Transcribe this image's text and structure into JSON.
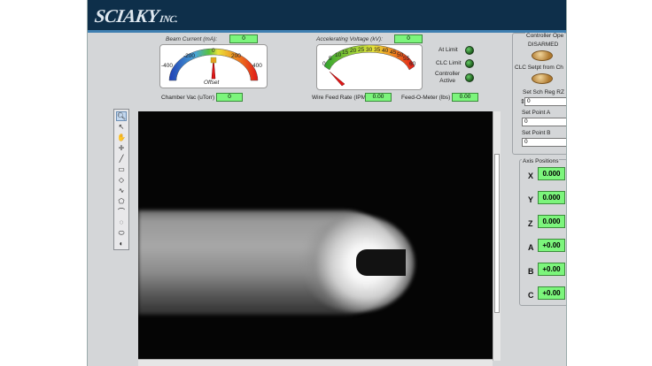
{
  "app": {
    "logo_text": "SCIAKY",
    "logo_suffix": "INC."
  },
  "beam_current": {
    "title": "Beam Current (mA):",
    "value": "0",
    "ticks": [
      "-400",
      "-200",
      "0",
      "200",
      "400"
    ],
    "center_label": "Offset",
    "offset_value": "0"
  },
  "accel_voltage": {
    "title": "Accelerating Voltage (kV):",
    "value": "0",
    "ticks": [
      "0",
      "5",
      "10",
      "15",
      "20",
      "25",
      "30",
      "35",
      "40",
      "45",
      "50",
      "55",
      "60"
    ]
  },
  "status": {
    "at_limit": "At Limit",
    "clc_limit": "CLC Limit",
    "controller_active_line1": "Controller",
    "controller_active_line2": "Active"
  },
  "readouts": {
    "chamber_vac_label": "Chamber Vac (uTorr)",
    "chamber_vac_value": "0",
    "wire_feed_label": "Wire Feed Rate (IPM)",
    "wire_feed_value": "0.00",
    "feed_o_meter_label": "Feed-O-Meter (lbs)",
    "feed_o_meter_value": "0.00"
  },
  "controller": {
    "title": "Controller Ope",
    "disarmed_label": "DISARMED",
    "clc_setpt_label": "CLC Setpt from Ch",
    "sch_reg_label": "Set Sch Reg RZ",
    "sch_reg_value": "0",
    "setpoint_a_label": "Set Point A",
    "setpoint_a_value": "0",
    "setpoint_b_label": "Set Point B",
    "setpoint_b_value": "0"
  },
  "axis_positions": {
    "title": "Axis Positions",
    "axes": [
      {
        "name": "X",
        "value": "0.000"
      },
      {
        "name": "Y",
        "value": "0.000"
      },
      {
        "name": "Z",
        "value": "0.000"
      },
      {
        "name": "A",
        "value": "+0.00"
      },
      {
        "name": "B",
        "value": "+0.00"
      },
      {
        "name": "C",
        "value": "+0.00"
      }
    ]
  },
  "tools": [
    "zoom-icon",
    "pointer-icon",
    "pan-icon",
    "crosshair-icon",
    "line-icon",
    "rectangle-icon",
    "rotated-rect-icon",
    "freehand-icon",
    "polygon-icon",
    "curve-icon",
    "annulus-icon",
    "ellipse-icon",
    "circle-icon"
  ],
  "colors": {
    "indicator_green": "#7cf57c",
    "header": "#0e2f4a",
    "led_green": "#2d8a2d"
  }
}
